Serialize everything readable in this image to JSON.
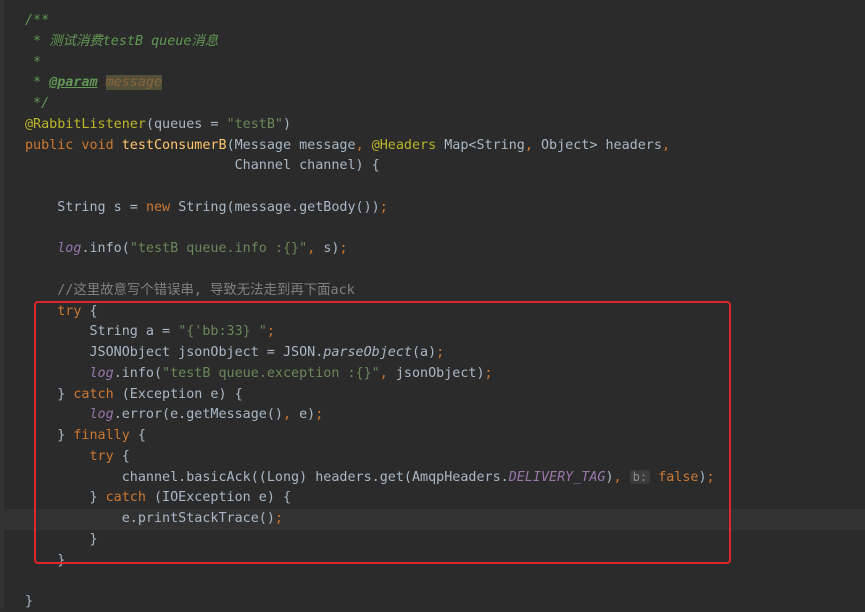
{
  "editor": {
    "lines": [
      [
        {
          "t": "/**",
          "c": "doc"
        }
      ],
      [
        {
          "t": " * 测试消费testB queue消息",
          "c": "doc"
        }
      ],
      [
        {
          "t": " *",
          "c": "doc"
        }
      ],
      [
        {
          "t": " * ",
          "c": "doc"
        },
        {
          "t": "@param",
          "c": "doctag"
        },
        {
          "t": " ",
          "c": "doc"
        },
        {
          "t": "message",
          "c": "docval"
        }
      ],
      [
        {
          "t": " */",
          "c": "doc"
        }
      ],
      [
        {
          "t": "@RabbitListener",
          "c": "anno"
        },
        {
          "t": "(queues = ",
          "c": "plain"
        },
        {
          "t": "\"testB\"",
          "c": "str"
        },
        {
          "t": ")",
          "c": "plain"
        }
      ],
      [
        {
          "t": "public void ",
          "c": "kw"
        },
        {
          "t": "testConsumerB",
          "c": "fn"
        },
        {
          "t": "(Message message",
          "c": "plain"
        },
        {
          "t": ", ",
          "c": "kw"
        },
        {
          "t": "@Headers ",
          "c": "anno"
        },
        {
          "t": "Map<String",
          "c": "plain"
        },
        {
          "t": ", ",
          "c": "kw"
        },
        {
          "t": "Object> headers",
          "c": "plain"
        },
        {
          "t": ",",
          "c": "kw"
        }
      ],
      [
        {
          "t": "                          Channel channel) {",
          "c": "plain"
        }
      ],
      [],
      [
        {
          "t": "    String s = ",
          "c": "plain"
        },
        {
          "t": "new ",
          "c": "kw"
        },
        {
          "t": "String(message.getBody())",
          "c": "plain"
        },
        {
          "t": ";",
          "c": "kw"
        }
      ],
      [],
      [
        {
          "t": "    ",
          "c": "plain"
        },
        {
          "t": "log",
          "c": "field"
        },
        {
          "t": ".info(",
          "c": "plain"
        },
        {
          "t": "\"testB queue.info :{}\"",
          "c": "str"
        },
        {
          "t": ", ",
          "c": "kw"
        },
        {
          "t": "s)",
          "c": "plain"
        },
        {
          "t": ";",
          "c": "kw"
        }
      ],
      [],
      [
        {
          "t": "    //这里故意写个错误串, 导致无法走到再下面ack",
          "c": "cmt"
        }
      ],
      [
        {
          "t": "    try ",
          "c": "kw"
        },
        {
          "t": "{",
          "c": "plain"
        }
      ],
      [
        {
          "t": "        String a = ",
          "c": "plain"
        },
        {
          "t": "\"{'bb:33} \"",
          "c": "str"
        },
        {
          "t": ";",
          "c": "kw"
        }
      ],
      [
        {
          "t": "        JSONObject jsonObject = JSON.",
          "c": "plain"
        },
        {
          "t": "parseObject",
          "c": "static"
        },
        {
          "t": "(a)",
          "c": "plain"
        },
        {
          "t": ";",
          "c": "kw"
        }
      ],
      [
        {
          "t": "        ",
          "c": "plain"
        },
        {
          "t": "log",
          "c": "field"
        },
        {
          "t": ".info(",
          "c": "plain"
        },
        {
          "t": "\"testB queue.exception :{}\"",
          "c": "str"
        },
        {
          "t": ", ",
          "c": "kw"
        },
        {
          "t": "jsonObject)",
          "c": "plain"
        },
        {
          "t": ";",
          "c": "kw"
        }
      ],
      [
        {
          "t": "    } ",
          "c": "plain"
        },
        {
          "t": "catch ",
          "c": "kw"
        },
        {
          "t": "(Exception e) {",
          "c": "plain"
        }
      ],
      [
        {
          "t": "        ",
          "c": "plain"
        },
        {
          "t": "log",
          "c": "field"
        },
        {
          "t": ".error(e.getMessage()",
          "c": "plain"
        },
        {
          "t": ", ",
          "c": "kw"
        },
        {
          "t": "e)",
          "c": "plain"
        },
        {
          "t": ";",
          "c": "kw"
        }
      ],
      [
        {
          "t": "    } ",
          "c": "plain"
        },
        {
          "t": "finally ",
          "c": "kw"
        },
        {
          "t": "{",
          "c": "plain"
        }
      ],
      [
        {
          "t": "        ",
          "c": "plain"
        },
        {
          "t": "try ",
          "c": "kw"
        },
        {
          "t": "{",
          "c": "plain"
        }
      ],
      [
        {
          "t": "            channel.basicAck((Long) headers.get(AmqpHeaders.",
          "c": "plain"
        },
        {
          "t": "DELIVERY_TAG",
          "c": "const"
        },
        {
          "t": ")",
          "c": "plain"
        },
        {
          "t": ", ",
          "c": "kw"
        },
        {
          "t": "b:",
          "c": "hint"
        },
        {
          "t": " false",
          "c": "kw"
        },
        {
          "t": ")",
          "c": "plain"
        },
        {
          "t": ";",
          "c": "kw"
        }
      ],
      [
        {
          "t": "        } ",
          "c": "plain"
        },
        {
          "t": "catch ",
          "c": "kw"
        },
        {
          "t": "(IOException e) {",
          "c": "plain"
        }
      ],
      [
        {
          "t": "            e.printStackTrace()",
          "c": "plain"
        },
        {
          "t": ";",
          "c": "kw"
        }
      ],
      [
        {
          "t": "        }",
          "c": "plain"
        }
      ],
      [
        {
          "t": "    }",
          "c": "plain"
        }
      ],
      [],
      [
        {
          "t": "}",
          "c": "plain"
        }
      ]
    ]
  },
  "colors": {
    "background": "#2b2b2b",
    "highlight_box": "#e0242b"
  }
}
